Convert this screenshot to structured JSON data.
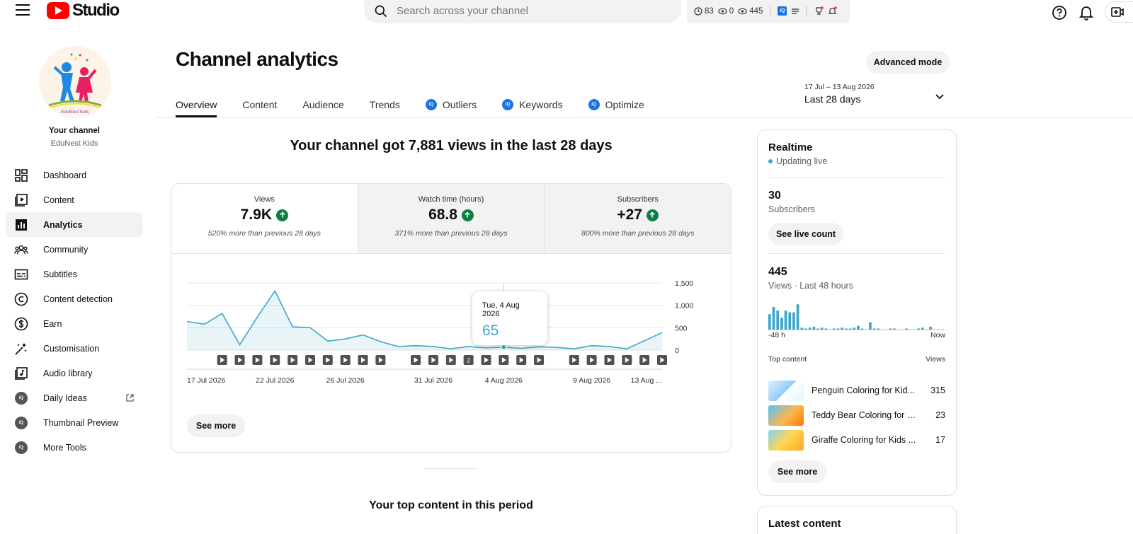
{
  "app": {
    "logo_text": "Studio"
  },
  "search": {
    "placeholder": "Search across your channel"
  },
  "top_stats": {
    "stat1": "83",
    "stat2": "0",
    "stat3": "445"
  },
  "sidebar": {
    "channel_label": "Your channel",
    "channel_name": "EduNest Kids",
    "avatar_text": "EduNest Kids",
    "items": [
      {
        "label": "Dashboard",
        "icon": "dashboard-icon"
      },
      {
        "label": "Content",
        "icon": "content-icon"
      },
      {
        "label": "Analytics",
        "icon": "analytics-icon"
      },
      {
        "label": "Community",
        "icon": "community-icon"
      },
      {
        "label": "Subtitles",
        "icon": "subtitles-icon"
      },
      {
        "label": "Content detection",
        "icon": "copyright-icon"
      },
      {
        "label": "Earn",
        "icon": "dollar-icon"
      },
      {
        "label": "Customisation",
        "icon": "magic-wand-icon"
      },
      {
        "label": "Audio library",
        "icon": "audio-library-icon"
      },
      {
        "label": "Daily Ideas",
        "icon": "vidiq-icon"
      },
      {
        "label": "Thumbnail Preview",
        "icon": "vidiq-icon"
      },
      {
        "label": "More Tools",
        "icon": "vidiq-icon"
      }
    ]
  },
  "header": {
    "title": "Channel analytics",
    "advanced_mode": "Advanced mode",
    "tabs": [
      "Overview",
      "Content",
      "Audience",
      "Trends",
      "Outliers",
      "Keywords",
      "Optimize"
    ],
    "date_range_small": "17 Jul – 13 Aug 2026",
    "date_range_label": "Last 28 days"
  },
  "main": {
    "headline": "Your channel got 7,881 views in the last 28 days",
    "metrics": [
      {
        "label": "Views",
        "value": "7.9K",
        "delta": "520% more than previous 28 days"
      },
      {
        "label": "Watch time (hours)",
        "value": "68.8",
        "delta": "371% more than previous 28 days"
      },
      {
        "label": "Subscribers",
        "value": "+27",
        "delta": "800% more than previous 28 days"
      }
    ],
    "see_more": "See more",
    "tooltip": {
      "date": "Tue, 4 Aug 2026",
      "value": "65"
    },
    "top_content_title": "Your top content in this period"
  },
  "chart_data": {
    "type": "area",
    "x": [
      "17 Jul 2026",
      "18 Jul 2026",
      "19 Jul 2026",
      "20 Jul 2026",
      "21 Jul 2026",
      "22 Jul 2026",
      "23 Jul 2026",
      "24 Jul 2026",
      "25 Jul 2026",
      "26 Jul 2026",
      "27 Jul 2026",
      "28 Jul 2026",
      "29 Jul 2026",
      "30 Jul 2026",
      "31 Jul 2026",
      "1 Aug 2026",
      "2 Aug 2026",
      "3 Aug 2026",
      "4 Aug 2026",
      "5 Aug 2026",
      "6 Aug 2026",
      "7 Aug 2026",
      "8 Aug 2026",
      "9 Aug 2026",
      "10 Aug 2026",
      "11 Aug 2026",
      "12 Aug 2026",
      "13 Aug 2026"
    ],
    "values": [
      640,
      580,
      820,
      120,
      740,
      1320,
      520,
      500,
      200,
      250,
      340,
      190,
      80,
      100,
      80,
      30,
      80,
      50,
      65,
      40,
      75,
      60,
      30,
      100,
      80,
      30,
      210,
      390
    ],
    "series_color": "#3ea6c8",
    "ylim": [
      0,
      1500
    ],
    "yticks": [
      "0",
      "500",
      "1,000",
      "1,500"
    ],
    "xtick_labels": [
      {
        "i": 0,
        "label": "17 Jul 2026"
      },
      {
        "i": 5,
        "label": "22 Jul 2026"
      },
      {
        "i": 9,
        "label": "26 Jul 2026"
      },
      {
        "i": 14,
        "label": "31 Jul 2026"
      },
      {
        "i": 18,
        "label": "4 Aug 2026"
      },
      {
        "i": 23,
        "label": "9 Aug 2026"
      },
      {
        "i": 27,
        "label": "13 Aug ..."
      }
    ],
    "upload_markers": [
      {
        "i": 2,
        "label": ""
      },
      {
        "i": 3,
        "label": ""
      },
      {
        "i": 4,
        "label": ""
      },
      {
        "i": 5,
        "label": ""
      },
      {
        "i": 6,
        "label": ""
      },
      {
        "i": 7,
        "label": ""
      },
      {
        "i": 8,
        "label": ""
      },
      {
        "i": 9,
        "label": ""
      },
      {
        "i": 10,
        "label": ""
      },
      {
        "i": 11,
        "label": ""
      },
      {
        "i": 13,
        "label": ""
      },
      {
        "i": 14,
        "label": ""
      },
      {
        "i": 15,
        "label": ""
      },
      {
        "i": 16,
        "label": "2"
      },
      {
        "i": 17,
        "label": ""
      },
      {
        "i": 18,
        "label": ""
      },
      {
        "i": 19,
        "label": ""
      },
      {
        "i": 20,
        "label": ""
      },
      {
        "i": 22,
        "label": ""
      },
      {
        "i": 23,
        "label": ""
      },
      {
        "i": 24,
        "label": ""
      },
      {
        "i": 25,
        "label": ""
      },
      {
        "i": 26,
        "label": ""
      },
      {
        "i": 27,
        "label": ""
      }
    ],
    "highlight_index": 18
  },
  "realtime": {
    "title": "Realtime",
    "live": "Updating live",
    "subs_value": "30",
    "subs_label": "Subscribers",
    "see_live": "See live count",
    "views_value": "445",
    "views_label": "Views · Last 48 hours",
    "bars": [
      18,
      26,
      22,
      14,
      22,
      20,
      20,
      29,
      3,
      2,
      3,
      4,
      2,
      3,
      2,
      1,
      2,
      2,
      3,
      2,
      2,
      3,
      5,
      2,
      1,
      9,
      2,
      2,
      1,
      1,
      2,
      2,
      1,
      1,
      2,
      1,
      1,
      2,
      3,
      1,
      4,
      1,
      1,
      1
    ],
    "axis_left": "-48 h",
    "axis_right": "Now",
    "top_content_label": "Top content",
    "views_col": "Views",
    "rows": [
      {
        "title": "Penguin Coloring for Kid...",
        "views": "315"
      },
      {
        "title": "Teddy Bear Coloring for Ki...",
        "views": "23"
      },
      {
        "title": "Giraffe Coloring for Kids ...",
        "views": "17"
      }
    ],
    "see_more": "See more"
  },
  "latest": {
    "title": "Latest content"
  }
}
